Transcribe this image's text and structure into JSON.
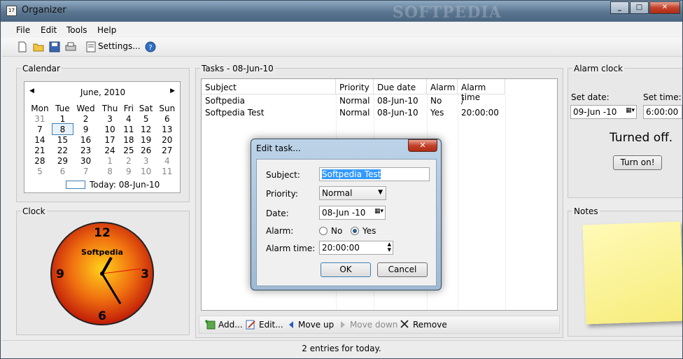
{
  "window": {
    "title": "Organizer",
    "watermark": "SOFTPEDIA",
    "min": "_",
    "max": "□",
    "close": "✕"
  },
  "menu": [
    "File",
    "Edit",
    "Tools",
    "Help"
  ],
  "toolbar": {
    "settings_label": "Settings..."
  },
  "calendar": {
    "title": "Calendar",
    "month": "June, 2010",
    "prev": "◀",
    "next": "▶",
    "days": [
      "Mon",
      "Tue",
      "Wed",
      "Thu",
      "Fri",
      "Sat",
      "Sun"
    ],
    "weeks": [
      [
        "31",
        "1",
        "2",
        "3",
        "4",
        "5",
        "6"
      ],
      [
        "7",
        "8",
        "9",
        "10",
        "11",
        "12",
        "13"
      ],
      [
        "14",
        "15",
        "16",
        "17",
        "18",
        "19",
        "20"
      ],
      [
        "21",
        "22",
        "23",
        "24",
        "25",
        "26",
        "27"
      ],
      [
        "28",
        "29",
        "30",
        "1",
        "2",
        "3",
        "4"
      ],
      [
        "5",
        "6",
        "7",
        "8",
        "9",
        "10",
        "11"
      ]
    ],
    "today": "Today: 08-Jun-10"
  },
  "clock": {
    "title": "Clock",
    "brand": "Softpedia",
    "n12": "12",
    "n3": "3",
    "n6": "6",
    "n9": "9"
  },
  "tasks": {
    "title": "Tasks - 08-Jun-10",
    "columns": [
      "Subject",
      "Priority",
      "Due date",
      "Alarm",
      "Alarm time"
    ],
    "rows": [
      [
        "Softpedia",
        "Normal",
        "08-Jun-10",
        "No",
        "/"
      ],
      [
        "Softpedia Test",
        "Normal",
        "08-Jun-10",
        "Yes",
        "20:00:00"
      ]
    ]
  },
  "actions": {
    "add": "Add...",
    "edit": "Edit...",
    "move_up": "Move up",
    "move_down": "Move down",
    "remove": "Remove"
  },
  "alarm": {
    "title": "Alarm clock",
    "set_date_label": "Set date:",
    "set_time_label": "Set time:",
    "date": "09-Jun -10",
    "time": "6:00:00",
    "status": "Turned off.",
    "button": "Turn on!"
  },
  "notes": {
    "title": "Notes"
  },
  "status": "2 entries for today.",
  "dialog": {
    "title": "Edit task...",
    "subject_label": "Subject:",
    "subject": "Softpedia Test",
    "priority_label": "Priority:",
    "priority": "Normal",
    "date_label": "Date:",
    "date": "08-Jun -10",
    "alarm_label": "Alarm:",
    "no": "No",
    "yes": "Yes",
    "alarm_time_label": "Alarm time:",
    "alarm_time": "20:00:00",
    "ok": "OK",
    "cancel": "Cancel"
  }
}
